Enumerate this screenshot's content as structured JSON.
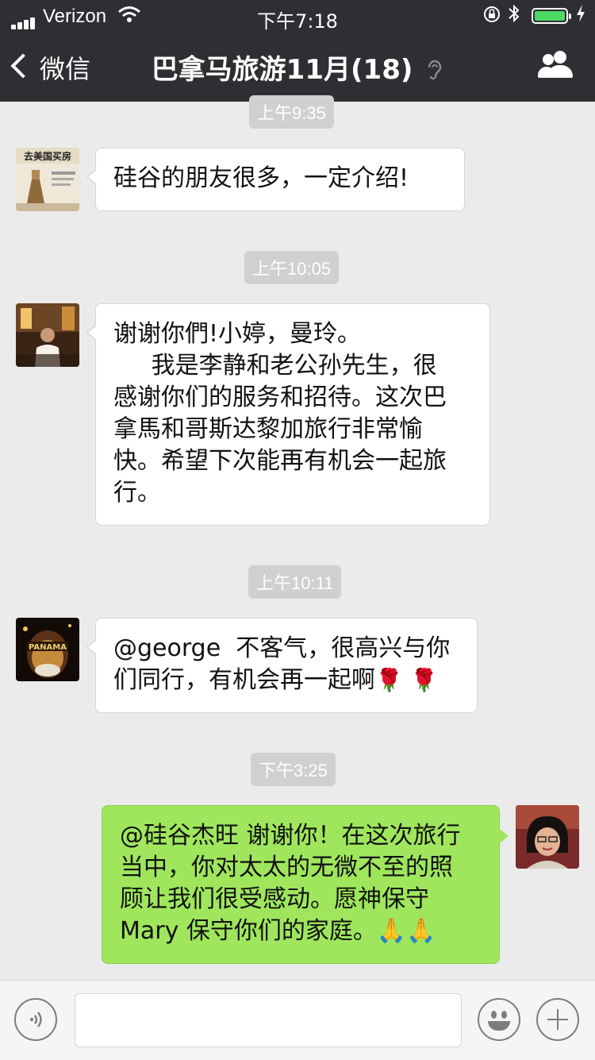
{
  "status_bar": {
    "carrier": "Verizon",
    "time": "下午7:18",
    "battery_level": 1.0
  },
  "nav": {
    "back_label": "微信",
    "title": "巴拿马旅游11月(18)",
    "icons": [
      "chevron-left-icon",
      "ear-icon",
      "group-members-icon"
    ]
  },
  "messages": [
    {
      "time": "上午9:35",
      "side": "left",
      "lines": [
        "硅谷的朋友很多，一定介绍!"
      ]
    },
    {
      "time": "上午10:05",
      "side": "left",
      "lines": [
        "谢谢你們!小婷，曼玲。",
        "     我是李静和老公孙先生，很",
        "感谢你们的服务和招待。这次巴",
        "拿馬和哥斯达黎加旅行非常愉",
        "快。希望下次能再有机会一起旅",
        "行。"
      ]
    },
    {
      "time": "上午10:11",
      "side": "left",
      "lines": [
        "@george  不客气，很高兴与你",
        "们同行，有机会再一起啊"
      ],
      "emoji": "rose"
    },
    {
      "time": "下午3:25",
      "side": "right",
      "lines": [
        "@硅谷杰旺 谢谢你！在这次旅行",
        "当中，你对太太的无微不至的照",
        "顾让我们很受感动。愿神保守",
        "Mary 保守你们的家庭。"
      ],
      "emoji": "folded-hands"
    }
  ],
  "avatar_texts": {
    "house_book": "去美国买房",
    "panama_bottle": "PANAMA"
  },
  "emoji_glyphs": {
    "rose": "🌹",
    "folded_hands": "🙏🙏"
  },
  "input_bar": {
    "icons": [
      "voice-icon",
      "emoji-icon",
      "plus-icon"
    ],
    "input_value": ""
  },
  "colors": {
    "nav_bg": "#2e2e33",
    "chat_bg": "#ebebeb",
    "incoming_bubble": "#ffffff",
    "outgoing_bubble": "#9fe65d",
    "timestamp_bg": "#d0d0d0"
  }
}
